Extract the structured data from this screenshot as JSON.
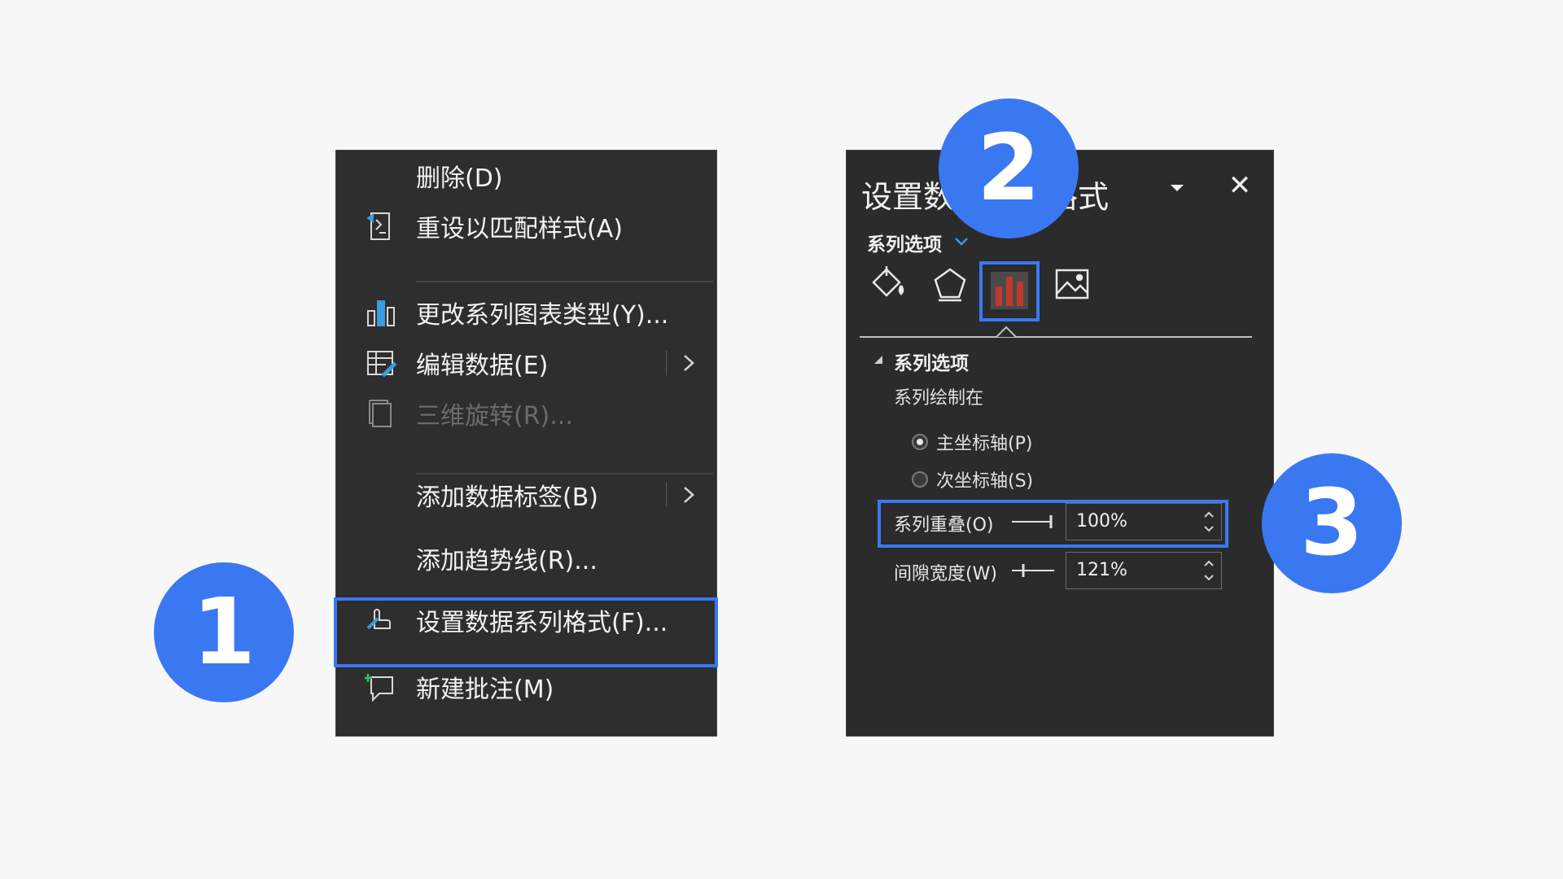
{
  "context_menu": {
    "items": [
      {
        "label": "删除(D)",
        "icon": "none",
        "disabled": false,
        "submenu": false
      },
      {
        "label": "重设以匹配样式(A)",
        "icon": "reset-style-icon",
        "disabled": false,
        "submenu": false
      },
      {
        "label": "更改系列图表类型(Y)...",
        "icon": "chart-type-icon",
        "disabled": false,
        "submenu": false
      },
      {
        "label": "编辑数据(E)",
        "icon": "edit-data-icon",
        "disabled": false,
        "submenu": true
      },
      {
        "label": "三维旋转(R)...",
        "icon": "3d-rotation-icon",
        "disabled": true,
        "submenu": false
      },
      {
        "label": "添加数据标签(B)",
        "icon": "none",
        "disabled": false,
        "submenu": true
      },
      {
        "label": "添加趋势线(R)...",
        "icon": "none",
        "disabled": false,
        "submenu": false
      },
      {
        "label": "设置数据系列格式(F)...",
        "icon": "format-series-icon",
        "disabled": false,
        "submenu": false,
        "highlighted": true
      },
      {
        "label": "新建批注(M)",
        "icon": "new-comment-icon",
        "disabled": false,
        "submenu": false
      }
    ]
  },
  "format_panel": {
    "title": "设置数据系列格式",
    "options_dropdown": "系列选项",
    "tabs": [
      {
        "name": "fill-line",
        "icon": "paint-bucket-icon"
      },
      {
        "name": "effects",
        "icon": "pentagon-icon"
      },
      {
        "name": "series-options",
        "icon": "bar-chart-icon",
        "active": true
      },
      {
        "name": "picture",
        "icon": "picture-icon"
      }
    ],
    "section_title": "系列选项",
    "plot_on_label": "系列绘制在",
    "axis_options": [
      {
        "label": "主坐标轴(P)",
        "selected": true
      },
      {
        "label": "次坐标轴(S)",
        "selected": false
      }
    ],
    "overlap": {
      "label": "系列重叠(O)",
      "value": "100%"
    },
    "gap_width": {
      "label": "间隙宽度(W)",
      "value": "121%"
    }
  },
  "steps": [
    "1",
    "2",
    "3"
  ],
  "colors": {
    "accent": "#3a78f2",
    "menu_bg": "#2e2e2e",
    "panel_bg": "#2b2b2b",
    "chart_icon": "#c0392b"
  }
}
